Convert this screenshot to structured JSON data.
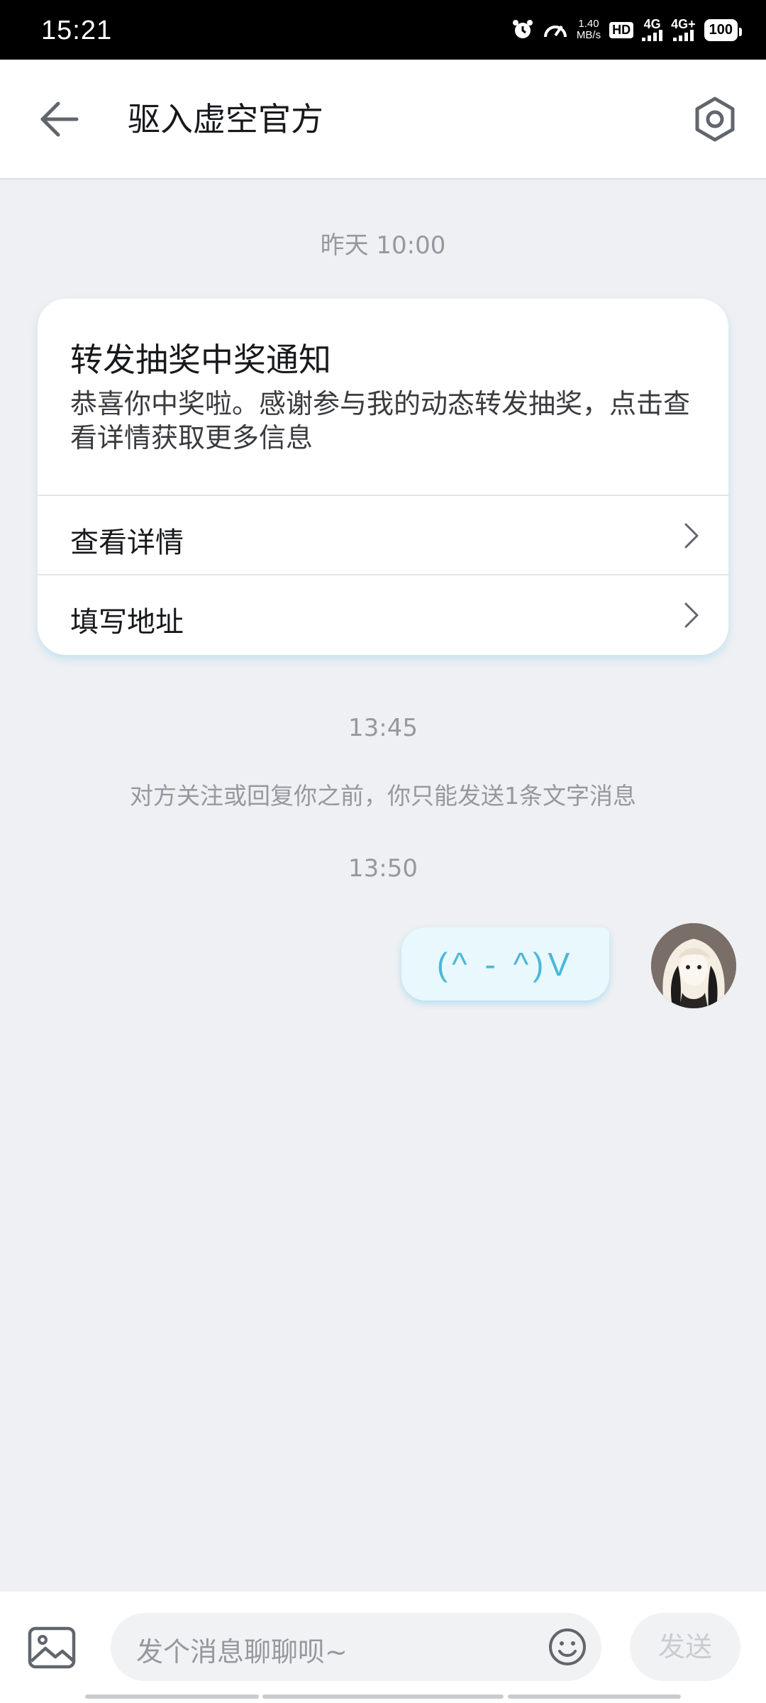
{
  "status_bar": {
    "time": "15:21",
    "net_speed_value": "1.40",
    "net_speed_unit": "MB/s",
    "hd_label": "HD",
    "sim1_label": "4G",
    "sim2_label": "4G+",
    "battery": "100",
    "icons": [
      "alarm-icon",
      "speedometer-icon",
      "signal-icon",
      "battery-icon"
    ]
  },
  "header": {
    "title": "驱入虚空官方",
    "back_icon": "back-arrow-icon",
    "settings_icon": "settings-icon"
  },
  "chat": {
    "timestamps": [
      "昨天 10:00",
      "13:45",
      "13:50"
    ],
    "card": {
      "title": "转发抽奖中奖通知",
      "body": "恭喜你中奖啦。感谢参与我的动态转发抽奖，点击查看详情获取更多信息",
      "rows": [
        {
          "label": "查看详情"
        },
        {
          "label": "填写地址"
        }
      ]
    },
    "notice": "对方关注或回复你之前，你只能发送1条文字消息",
    "my_message": "(^ - ^)V"
  },
  "input_bar": {
    "placeholder": "发个消息聊聊呗~",
    "send_label": "发送",
    "image_icon": "image-icon",
    "emoji_icon": "emoji-icon"
  },
  "colors": {
    "background": "#eff0f3",
    "bubble_bg": "#e8f8fd",
    "bubble_text": "#4ab7d9",
    "muted_text": "#9499a0"
  }
}
